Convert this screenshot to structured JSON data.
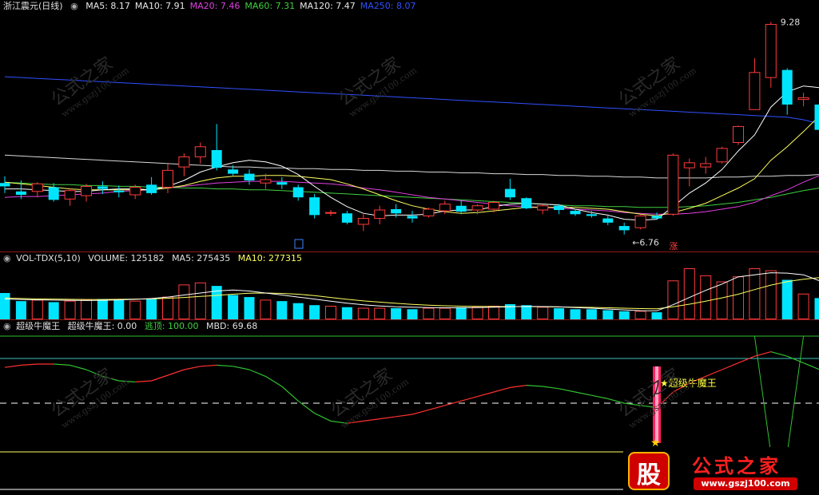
{
  "price": {
    "stock_name": "浙江震元",
    "period": "(日线)",
    "ma": [
      {
        "label": "MA5: 8.17",
        "color": "#e8e8e8"
      },
      {
        "label": "MA10: 7.91",
        "color": "#e8e8e8"
      },
      {
        "label": "MA20: 7.46",
        "color": "#e040e0"
      },
      {
        "label": "MA60: 7.31",
        "color": "#40d040"
      },
      {
        "label": "MA120: 7.47",
        "color": "#e8e8e8"
      },
      {
        "label": "MA250: 8.07",
        "color": "#3050ff"
      }
    ],
    "high_label": "9.28",
    "low_label": "6.76",
    "zhang_label": "涨",
    "candles": [
      [
        7.37,
        7.45,
        7.25,
        7.33
      ],
      [
        7.27,
        7.4,
        7.18,
        7.23
      ],
      [
        7.27,
        7.38,
        7.2,
        7.36
      ],
      [
        7.32,
        7.37,
        7.15,
        7.17
      ],
      [
        7.18,
        7.31,
        7.1,
        7.28
      ],
      [
        7.22,
        7.36,
        7.15,
        7.33
      ],
      [
        7.33,
        7.39,
        7.24,
        7.3
      ],
      [
        7.28,
        7.34,
        7.2,
        7.26
      ],
      [
        7.23,
        7.35,
        7.18,
        7.32
      ],
      [
        7.35,
        7.44,
        7.23,
        7.25
      ],
      [
        7.32,
        7.6,
        7.25,
        7.52
      ],
      [
        7.56,
        7.72,
        7.45,
        7.68
      ],
      [
        7.68,
        7.85,
        7.6,
        7.8
      ],
      [
        7.76,
        8.07,
        7.52,
        7.55
      ],
      [
        7.53,
        7.58,
        7.46,
        7.48
      ],
      [
        7.48,
        7.53,
        7.35,
        7.4
      ],
      [
        7.37,
        7.48,
        7.3,
        7.41
      ],
      [
        7.38,
        7.44,
        7.3,
        7.35
      ],
      [
        7.32,
        7.35,
        7.16,
        7.2
      ],
      [
        7.2,
        7.24,
        6.95,
        6.99
      ],
      [
        7.02,
        7.05,
        6.98,
        7.02
      ],
      [
        7.01,
        7.04,
        6.88,
        6.9
      ],
      [
        6.88,
        7.0,
        6.8,
        6.95
      ],
      [
        6.95,
        7.1,
        6.88,
        7.05
      ],
      [
        7.06,
        7.12,
        6.96,
        7.01
      ],
      [
        6.98,
        7.04,
        6.9,
        6.95
      ],
      [
        6.98,
        7.08,
        6.96,
        7.06
      ],
      [
        7.04,
        7.16,
        7.0,
        7.12
      ],
      [
        7.1,
        7.16,
        7.0,
        7.03
      ],
      [
        7.05,
        7.12,
        7.0,
        7.1
      ],
      [
        7.06,
        7.16,
        7.02,
        7.14
      ],
      [
        7.3,
        7.42,
        7.17,
        7.2
      ],
      [
        7.19,
        7.2,
        7.06,
        7.07
      ],
      [
        7.05,
        7.12,
        7.0,
        7.1
      ],
      [
        7.1,
        7.12,
        7.0,
        7.05
      ],
      [
        7.04,
        7.06,
        6.98,
        7.0
      ],
      [
        7.0,
        7.04,
        6.96,
        6.98
      ],
      [
        6.95,
        6.98,
        6.87,
        6.9
      ],
      [
        6.86,
        6.9,
        6.76,
        6.81
      ],
      [
        6.84,
        6.99,
        6.82,
        6.98
      ],
      [
        6.98,
        7.02,
        6.94,
        6.95
      ],
      [
        7.0,
        7.72,
        6.98,
        7.7
      ],
      [
        7.55,
        7.66,
        7.33,
        7.61
      ],
      [
        7.56,
        7.68,
        7.48,
        7.6
      ],
      [
        7.62,
        7.8,
        7.6,
        7.78
      ],
      [
        7.85,
        8.05,
        7.82,
        8.04
      ],
      [
        8.24,
        8.85,
        8.24,
        8.68
      ],
      [
        8.62,
        9.28,
        8.5,
        9.25
      ],
      [
        8.71,
        8.73,
        8.18,
        8.3
      ],
      [
        8.36,
        8.44,
        8.28,
        8.38
      ],
      [
        8.3,
        8.32,
        7.98,
        8.0
      ]
    ],
    "ma5": [
      7.3,
      7.3,
      7.29,
      7.28,
      7.27,
      7.27,
      7.29,
      7.3,
      7.3,
      7.29,
      7.33,
      7.4,
      7.5,
      7.56,
      7.61,
      7.64,
      7.62,
      7.57,
      7.47,
      7.33,
      7.2,
      7.09,
      7.01,
      6.98,
      6.99,
      6.99,
      7.0,
      7.04,
      7.05,
      7.05,
      7.09,
      7.12,
      7.13,
      7.12,
      7.11,
      7.06,
      7.02,
      6.99,
      6.94,
      6.93,
      6.94,
      7.09,
      7.25,
      7.37,
      7.53,
      7.75,
      7.94,
      8.27,
      8.45,
      8.52,
      8.5
    ],
    "ma10": [
      7.38,
      7.36,
      7.34,
      7.32,
      7.3,
      7.29,
      7.29,
      7.29,
      7.29,
      7.29,
      7.31,
      7.34,
      7.39,
      7.43,
      7.45,
      7.45,
      7.46,
      7.46,
      7.45,
      7.43,
      7.41,
      7.36,
      7.3,
      7.23,
      7.16,
      7.1,
      7.06,
      7.03,
      7.01,
      7.02,
      7.04,
      7.06,
      7.08,
      7.08,
      7.08,
      7.08,
      7.07,
      7.06,
      7.03,
      7.0,
      6.98,
      7.02,
      7.07,
      7.13,
      7.22,
      7.31,
      7.42,
      7.64,
      7.8,
      7.98,
      8.17
    ],
    "ma20": [
      7.2,
      7.21,
      7.21,
      7.22,
      7.23,
      7.24,
      7.25,
      7.27,
      7.28,
      7.29,
      7.31,
      7.33,
      7.35,
      7.37,
      7.38,
      7.39,
      7.39,
      7.39,
      7.38,
      7.37,
      7.36,
      7.34,
      7.31,
      7.29,
      7.26,
      7.23,
      7.2,
      7.18,
      7.16,
      7.14,
      7.12,
      7.1,
      7.09,
      7.08,
      7.07,
      7.06,
      7.05,
      7.04,
      7.02,
      7.01,
      7.0,
      7.0,
      7.01,
      7.03,
      7.06,
      7.09,
      7.14,
      7.22,
      7.29,
      7.38,
      7.46
    ],
    "ma60": [
      7.38,
      7.37,
      7.36,
      7.35,
      7.35,
      7.34,
      7.34,
      7.33,
      7.33,
      7.32,
      7.32,
      7.31,
      7.31,
      7.3,
      7.3,
      7.29,
      7.29,
      7.28,
      7.27,
      7.26,
      7.25,
      7.24,
      7.23,
      7.22,
      7.21,
      7.2,
      7.19,
      7.18,
      7.17,
      7.16,
      7.15,
      7.14,
      7.13,
      7.12,
      7.11,
      7.1,
      7.1,
      7.09,
      7.09,
      7.08,
      7.08,
      7.08,
      7.09,
      7.1,
      7.12,
      7.14,
      7.17,
      7.2,
      7.24,
      7.28,
      7.31
    ],
    "ma120": [
      7.7,
      7.69,
      7.68,
      7.67,
      7.66,
      7.65,
      7.64,
      7.63,
      7.62,
      7.61,
      7.6,
      7.59,
      7.58,
      7.57,
      7.56,
      7.56,
      7.55,
      7.55,
      7.54,
      7.54,
      7.53,
      7.53,
      7.52,
      7.52,
      7.51,
      7.51,
      7.5,
      7.5,
      7.49,
      7.49,
      7.48,
      7.48,
      7.47,
      7.47,
      7.46,
      7.46,
      7.45,
      7.45,
      7.44,
      7.44,
      7.43,
      7.43,
      7.43,
      7.43,
      7.44,
      7.44,
      7.45,
      7.45,
      7.46,
      7.46,
      7.47
    ],
    "ma250": [
      8.63,
      8.62,
      8.61,
      8.6,
      8.59,
      8.58,
      8.57,
      8.56,
      8.55,
      8.54,
      8.53,
      8.52,
      8.51,
      8.5,
      8.49,
      8.48,
      8.47,
      8.46,
      8.45,
      8.44,
      8.43,
      8.42,
      8.41,
      8.4,
      8.39,
      8.38,
      8.37,
      8.36,
      8.35,
      8.34,
      8.33,
      8.32,
      8.31,
      8.3,
      8.29,
      8.28,
      8.27,
      8.26,
      8.25,
      8.24,
      8.23,
      8.22,
      8.21,
      8.2,
      8.19,
      8.18,
      8.17,
      8.16,
      8.15,
      8.12,
      8.07
    ]
  },
  "volume": {
    "header": "VOL-TDX(5,10)",
    "volume_label": "VOLUME: 125182",
    "ma5_label": "MA5: 275435",
    "ma10_label": "MA10: 277315",
    "values": [
      130,
      90,
      95,
      85,
      90,
      95,
      100,
      95,
      90,
      100,
      110,
      170,
      180,
      165,
      120,
      110,
      95,
      90,
      80,
      70,
      65,
      60,
      55,
      55,
      55,
      50,
      55,
      55,
      60,
      60,
      65,
      75,
      70,
      60,
      55,
      50,
      50,
      45,
      40,
      40,
      35,
      190,
      250,
      215,
      185,
      210,
      250,
      240,
      195,
      125,
      105
    ],
    "ma5": [
      100,
      98,
      96,
      95,
      94,
      93,
      94,
      96,
      99,
      103,
      110,
      120,
      130,
      140,
      145,
      140,
      130,
      120,
      110,
      100,
      90,
      80,
      72,
      66,
      62,
      60,
      58,
      57,
      57,
      58,
      60,
      62,
      64,
      63,
      62,
      58,
      55,
      51,
      47,
      43,
      42,
      72,
      108,
      143,
      174,
      210,
      220,
      230,
      228,
      220,
      190
    ],
    "ma10": [
      105,
      103,
      101,
      100,
      99,
      98,
      98,
      99,
      100,
      101,
      104,
      108,
      113,
      118,
      124,
      129,
      130,
      128,
      124,
      117,
      108,
      99,
      91,
      85,
      79,
      74,
      70,
      67,
      65,
      64,
      63,
      63,
      63,
      62,
      61,
      60,
      59,
      57,
      55,
      53,
      52,
      62,
      75,
      90,
      106,
      124,
      147,
      169,
      186,
      198,
      206
    ]
  },
  "indicator": {
    "name": "超级牛魔王",
    "value_label": "超级牛魔王: 0.00",
    "escape_label": "逃顶: 100.00",
    "mbd_label": "MBD: 69.68",
    "signal_label": "★超级牛魔王",
    "mbd": [
      72,
      74,
      75,
      75,
      74,
      70,
      64,
      60,
      59,
      60,
      65,
      70,
      73,
      74,
      73,
      70,
      64,
      55,
      42,
      31,
      24,
      22,
      24,
      26,
      28,
      30,
      34,
      38,
      42,
      46,
      50,
      54,
      56,
      55,
      53,
      50,
      47,
      44,
      40,
      38,
      36,
      50,
      58,
      64,
      70,
      76,
      82,
      86,
      82,
      76,
      70
    ],
    "escape": [
      null,
      null,
      null,
      null,
      null,
      null,
      null,
      null,
      null,
      null,
      null,
      null,
      null,
      null,
      null,
      null,
      null,
      null,
      null,
      null,
      null,
      null,
      null,
      null,
      null,
      null,
      null,
      null,
      null,
      null,
      null,
      null,
      null,
      null,
      null,
      null,
      null,
      null,
      null,
      null,
      null,
      null,
      null,
      null,
      null,
      100,
      100,
      -5,
      -5,
      100,
      100
    ]
  },
  "watermark": {
    "cn": "公式之家",
    "url": "www.gszj100.com",
    "logo_char": "股"
  },
  "colors": {
    "up": "#ff3b3b",
    "down": "#00e5ff",
    "bg": "#000000",
    "grid": "#8b1a1a"
  }
}
